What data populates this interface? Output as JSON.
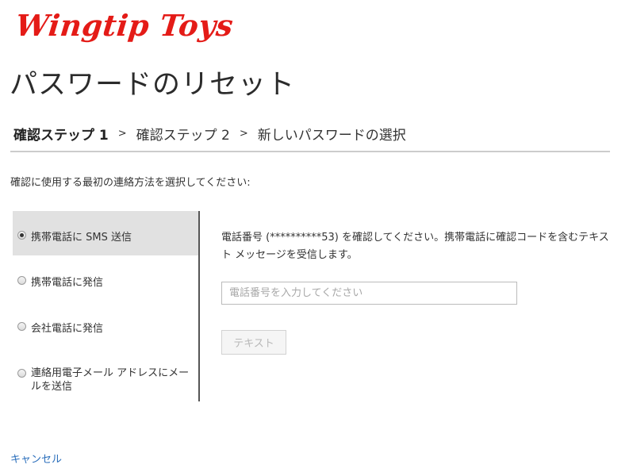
{
  "header": {
    "logo_text": "Wingtip Toys",
    "logo_color": "#e41b17",
    "title": "パスワードのリセット"
  },
  "breadcrumb": {
    "steps": [
      {
        "label": "確認ステップ 1",
        "active": true
      },
      {
        "label": "確認ステップ 2",
        "active": false
      },
      {
        "label": "新しいパスワードの選択",
        "active": false
      }
    ],
    "separator": ">"
  },
  "instruction": "確認に使用する最初の連絡方法を選択してください:",
  "methods": [
    {
      "label": "携帯電話に SMS 送信",
      "selected": true
    },
    {
      "label": "携帯電話に発信",
      "selected": false
    },
    {
      "label": "会社電話に発信",
      "selected": false
    },
    {
      "label": "連絡用電子メール アドレスにメールを送信",
      "selected": false
    }
  ],
  "detail": {
    "description": "電話番号 (**********53) を確認してください。携帯電話に確認コードを含むテキスト メッセージを受信します。",
    "phone_input": {
      "value": "",
      "placeholder": "電話番号を入力してください"
    },
    "text_button_label": "テキスト"
  },
  "footer": {
    "cancel_label": "キャンセル",
    "link_color": "#2a6ebb"
  }
}
